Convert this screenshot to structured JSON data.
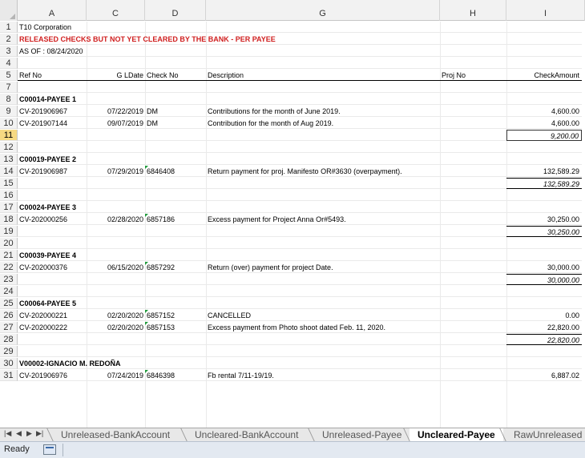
{
  "columns": [
    "A",
    "C",
    "D",
    "G",
    "H",
    "I"
  ],
  "rows": [
    {
      "n": "1",
      "a": "T10 Corporation"
    },
    {
      "n": "2",
      "a": "RELEASED CHECKS BUT NOT YET CLEARED BY THE BANK - PER PAYEE",
      "style": "red"
    },
    {
      "n": "3",
      "a": "AS OF : 08/24/2020"
    },
    {
      "n": "4"
    },
    {
      "n": "5",
      "a": "Ref No",
      "c": "G LDate",
      "d": "Check No",
      "g": "Description",
      "h": "Proj No",
      "i": "CheckAmount",
      "style": "header"
    },
    {
      "n": "7"
    },
    {
      "n": "8",
      "a": "C00014-PAYEE 1",
      "style": "bold"
    },
    {
      "n": "9",
      "a": "CV-201906967",
      "c": "07/22/2019",
      "d": "DM",
      "g": "Contributions for the month of June 2019.",
      "i": "4,600.00"
    },
    {
      "n": "10",
      "a": "CV-201907144",
      "c": "09/07/2019",
      "d": "DM",
      "g": "Contribution for the month of Aug 2019.",
      "i": "4,600.00"
    },
    {
      "n": "11",
      "i": "9,200.00",
      "style": "total",
      "selected": true
    },
    {
      "n": "12"
    },
    {
      "n": "13",
      "a": "C00019-PAYEE 2",
      "style": "bold"
    },
    {
      "n": "14",
      "a": "CV-201906987",
      "c": "07/29/2019",
      "d": "6846408",
      "g": "Return payment for proj. Manifesto OR#3630 (overpayment).",
      "i": "132,589.29",
      "tri": true
    },
    {
      "n": "15",
      "i": "132,589.29",
      "style": "total"
    },
    {
      "n": "16"
    },
    {
      "n": "17",
      "a": "C00024-PAYEE 3",
      "style": "bold"
    },
    {
      "n": "18",
      "a": "CV-202000256",
      "c": "02/28/2020",
      "d": "6857186",
      "g": "Excess payment for Project Anna Or#5493.",
      "i": "30,250.00",
      "tri": true
    },
    {
      "n": "19",
      "i": "30,250.00",
      "style": "total"
    },
    {
      "n": "20"
    },
    {
      "n": "21",
      "a": "C00039-PAYEE 4",
      "style": "bold"
    },
    {
      "n": "22",
      "a": "CV-202000376",
      "c": "06/15/2020",
      "d": "6857292",
      "g": "Return (over) payment for project Date.",
      "i": "30,000.00",
      "tri": true
    },
    {
      "n": "23",
      "i": "30,000.00",
      "style": "total"
    },
    {
      "n": "24"
    },
    {
      "n": "25",
      "a": "C00064-PAYEE 5",
      "style": "bold"
    },
    {
      "n": "26",
      "a": "CV-202000221",
      "c": "02/20/2020",
      "d": "6857152",
      "g": "CANCELLED",
      "i": "0.00",
      "tri": true
    },
    {
      "n": "27",
      "a": "CV-202000222",
      "c": "02/20/2020",
      "d": "6857153",
      "g": "Excess payment from Photo shoot dated Feb. 11, 2020.",
      "i": "22,820.00",
      "tri": true
    },
    {
      "n": "28",
      "i": "22,820.00",
      "style": "total"
    },
    {
      "n": "29"
    },
    {
      "n": "30",
      "a": "V00002-IGNACIO M. REDOÑA",
      "style": "bold"
    },
    {
      "n": "31",
      "a": "CV-201906976",
      "c": "07/24/2019",
      "d": "6846398",
      "g": "Fb rental 7/11-19/19.",
      "i": "6,887.02",
      "tri": true
    }
  ],
  "sheet_tabs": [
    {
      "label": "Unreleased-BankAccount",
      "active": false
    },
    {
      "label": "Uncleared-BankAccount",
      "active": false
    },
    {
      "label": "Unreleased-Payee",
      "active": false
    },
    {
      "label": "Uncleared-Payee",
      "active": true
    },
    {
      "label": "RawUnreleased",
      "active": false
    }
  ],
  "nav_icons": [
    "first-sheet-icon",
    "prev-sheet-icon",
    "next-sheet-icon",
    "last-sheet-icon"
  ],
  "status": {
    "ready": "Ready"
  },
  "colors": {
    "title_red": "#d02020",
    "selected_row_header": "#f6d982",
    "triangle_green": "#1e9a3a"
  }
}
